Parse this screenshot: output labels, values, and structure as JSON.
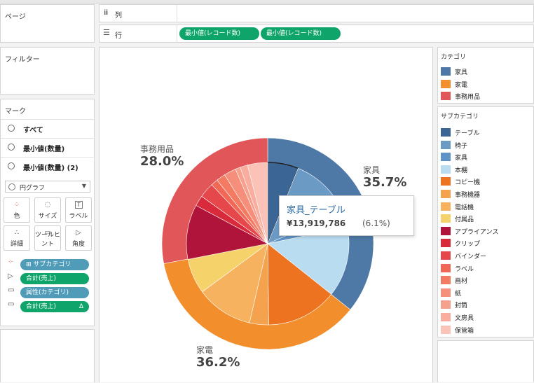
{
  "shelves": {
    "pages_title": "ページ",
    "columns_label": "列",
    "rows_label": "行",
    "rows_pills": [
      "最小値(レコード数)",
      "最小値(レコード数)"
    ]
  },
  "filters": {
    "title": "フィルター"
  },
  "marks": {
    "title": "マーク",
    "layers": [
      "すべて",
      "最小値(数量)",
      "最小値(数量) (2)"
    ],
    "mark_type": "円グラフ",
    "buttons": [
      "色",
      "サイズ",
      "ラベル",
      "詳細",
      "ツールヒント",
      "角度"
    ],
    "fields": [
      {
        "label": "サブカテゴリ",
        "color": "#4f9bb8"
      },
      {
        "label": "合計(売上)",
        "color": "#0fa56a"
      },
      {
        "label": "属性(カテゴリ)",
        "color": "#4f9bb8"
      },
      {
        "label": "合計(売上)",
        "color": "#0fa56a",
        "extra": "Δ"
      }
    ]
  },
  "chart_labels": {
    "office": {
      "name": "事務用品",
      "pct": "28.0%"
    },
    "furniture": {
      "name": "家具",
      "pct": "35.7%"
    },
    "appliance": {
      "name": "家電",
      "pct": "36.2%"
    }
  },
  "tooltip": {
    "title": "家具_テーブル",
    "value": "¥13,919,786",
    "pct": "(6.1%)"
  },
  "chart_data": {
    "type": "pie",
    "outer": [
      {
        "label": "家具",
        "pct": 35.7,
        "color": "#4e79a7"
      },
      {
        "label": "家電",
        "pct": 36.2,
        "color": "#f28e2b"
      },
      {
        "label": "事務用品",
        "pct": 28.0,
        "color": "#e15759"
      }
    ],
    "inner": [
      {
        "label": "テーブル",
        "pct": 6.1
      },
      {
        "label": "椅子",
        "pct": 12.4
      },
      {
        "label": "家具",
        "pct": 3.2
      },
      {
        "label": "本棚",
        "pct": 14.0
      },
      {
        "label": "コピー機",
        "pct": 14.1
      },
      {
        "label": "事務機器",
        "pct": 3.8
      },
      {
        "label": "電話機",
        "pct": 11.3
      },
      {
        "label": "付属品",
        "pct": 7.0
      },
      {
        "label": "アプライアンス",
        "pct": 10.9
      },
      {
        "label": "クリップ",
        "pct": 2.1
      },
      {
        "label": "バインダー",
        "pct": 3.0
      },
      {
        "label": "ラベル",
        "pct": 1.4
      },
      {
        "label": "画材",
        "pct": 1.8
      },
      {
        "label": "紙",
        "pct": 2.4
      },
      {
        "label": "封筒",
        "pct": 1.0
      },
      {
        "label": "文房具",
        "pct": 1.5
      },
      {
        "label": "保管箱",
        "pct": 4.0
      }
    ]
  },
  "legend_category": {
    "title": "カテゴリ",
    "items": [
      {
        "label": "家具",
        "color": "#4e79a7"
      },
      {
        "label": "家電",
        "color": "#f28e2b"
      },
      {
        "label": "事務用品",
        "color": "#e15759"
      }
    ]
  },
  "legend_subcategory": {
    "title": "サブカテゴリ",
    "items": [
      {
        "label": "テーブル",
        "color": "#3a6594"
      },
      {
        "label": "椅子",
        "color": "#6b9ac4"
      },
      {
        "label": "家具",
        "color": "#5f93c7"
      },
      {
        "label": "本棚",
        "color": "#b9dcf1"
      },
      {
        "label": "コピー機",
        "color": "#ee7320"
      },
      {
        "label": "事務機器",
        "color": "#f4a24d"
      },
      {
        "label": "電話機",
        "color": "#f6b25f"
      },
      {
        "label": "付属品",
        "color": "#f6d36a"
      },
      {
        "label": "アプライアンス",
        "color": "#b1143a"
      },
      {
        "label": "クリップ",
        "color": "#d82a3a"
      },
      {
        "label": "バインダー",
        "color": "#e6474b"
      },
      {
        "label": "ラベル",
        "color": "#f16857"
      },
      {
        "label": "画材",
        "color": "#f27b62"
      },
      {
        "label": "紙",
        "color": "#f58f7c"
      },
      {
        "label": "封筒",
        "color": "#f6a08e"
      },
      {
        "label": "文房具",
        "color": "#f8ad9f"
      },
      {
        "label": "保管箱",
        "color": "#fbc3b8"
      }
    ]
  }
}
